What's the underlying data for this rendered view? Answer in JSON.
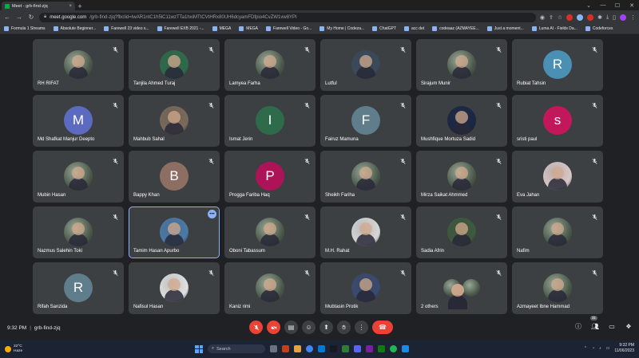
{
  "browser": {
    "tab_title": "Meet - grb-find-zjq",
    "tab_close": "×",
    "new_tab": "+",
    "url_host": "meet.google.com",
    "url_path": "/grb-find-zjq?fbclid=IwAR1ntC1h5lC11wzTTa1hxiMTtCVtHRx80UH6dcyamFDfpio4CvZW1vw8YPI",
    "bookmarks": [
      "Formula 1 Streams",
      "Absolute Beginner...",
      "Farewell 23 video s...",
      "Farewell EXB 2021 -...",
      "MEGA",
      "MEGA",
      "Farewell Video - Go...",
      "My Home | Codeza...",
      "ChatGPT",
      "acc det",
      "codeaaz (AZMAYEE...",
      "Just a moment...",
      "Luma AI - Fields Da...",
      "Codeforces"
    ]
  },
  "participants": [
    {
      "name": "RH RIFAT",
      "initial": "",
      "color": ""
    },
    {
      "name": "Tanjila Ahmed Turaj",
      "initial": "",
      "color": "#2e6b4a"
    },
    {
      "name": "Lamyea Farha",
      "initial": "",
      "color": ""
    },
    {
      "name": "Lutful",
      "initial": "",
      "color": "#3a4a5c"
    },
    {
      "name": "Sirajum Munir",
      "initial": "",
      "color": ""
    },
    {
      "name": "Rubiat Tahsin",
      "initial": "R",
      "color": "#4b8fb3"
    },
    {
      "name": "Md Shafkat Manjur Deepto",
      "initial": "M",
      "color": "#5c6bc0"
    },
    {
      "name": "Mahbub Sahal",
      "initial": "",
      "color": "#7a6a5a"
    },
    {
      "name": "Ismat Jerin",
      "initial": "I",
      "color": "#2e6b4a"
    },
    {
      "name": "Fairuz Mamuna",
      "initial": "F",
      "color": "#607d8b"
    },
    {
      "name": "Mushfique Mortuza Sadid",
      "initial": "",
      "color": "#1a2744"
    },
    {
      "name": "sristi paul",
      "initial": "s",
      "color": "#c2185b"
    },
    {
      "name": "Mubin Hasan",
      "initial": "",
      "color": ""
    },
    {
      "name": "Bappy Khan",
      "initial": "B",
      "color": "#8d6e63"
    },
    {
      "name": "Progga Fariba Haq",
      "initial": "P",
      "color": "#ad1457"
    },
    {
      "name": "Sheikh Fariha",
      "initial": "",
      "color": ""
    },
    {
      "name": "Mirza Saikat Ahmmed",
      "initial": "",
      "color": ""
    },
    {
      "name": "Eva Jahan",
      "initial": "",
      "color": "#d9c7c7"
    },
    {
      "name": "Nazmus Salehin Toki",
      "initial": "",
      "color": ""
    },
    {
      "name": "Tamim Hasan Apurbo",
      "initial": "",
      "color": "#4a7aa8"
    },
    {
      "name": "Oboni Tabassum",
      "initial": "",
      "color": ""
    },
    {
      "name": "M.H. Rahat",
      "initial": "",
      "color": "#d7d7d7"
    },
    {
      "name": "Sadia Afrin",
      "initial": "",
      "color": "#3d5a3d"
    },
    {
      "name": "Nafim",
      "initial": "",
      "color": ""
    },
    {
      "name": "Rifah Sanzida",
      "initial": "R",
      "color": "#607d8b"
    },
    {
      "name": "Nafisul Hasan",
      "initial": "",
      "color": "#e0e0e0"
    },
    {
      "name": "Kaniz rimi",
      "initial": "",
      "color": ""
    },
    {
      "name": "Mubtasin Protik",
      "initial": "",
      "color": "#3a4a70"
    },
    {
      "name": "2 others",
      "initial": "",
      "color": "",
      "group": true
    },
    {
      "name": "Azmayeet Ibne Hammad",
      "initial": "",
      "color": ""
    }
  ],
  "active_tile": "Tamim Hasan Apurbo",
  "more_glyph": "•••",
  "meeting": {
    "time": "9:32 PM",
    "separator": "|",
    "code": "grb-find-zjq",
    "people_count": "31"
  },
  "taskbar": {
    "temp": "22°C",
    "weather": "Haze",
    "search": "Search",
    "time": "9:32 PM",
    "date": "11/06/2023"
  },
  "colors": {
    "accent": "#8ab4f8",
    "danger": "#ea4335",
    "tile": "#3c4043"
  }
}
